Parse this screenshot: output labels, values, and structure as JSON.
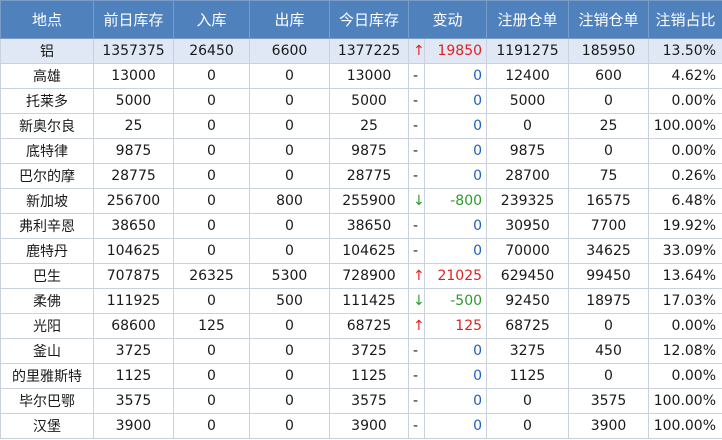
{
  "headers": [
    "地点",
    "前日库存",
    "入库",
    "出库",
    "今日库存",
    "变动",
    "注册仓单",
    "注销仓单",
    "注销占比"
  ],
  "rows": [
    {
      "location": "铝",
      "prev": "1357375",
      "in": "26450",
      "out": "6600",
      "today": "1377225",
      "symbol": "↑",
      "change": "19850",
      "dir": "up",
      "registered": "1191275",
      "cancelled": "185950",
      "ratio": "13.50%"
    },
    {
      "location": "高雄",
      "prev": "13000",
      "in": "0",
      "out": "0",
      "today": "13000",
      "symbol": "-",
      "change": "0",
      "dir": "flat",
      "registered": "12400",
      "cancelled": "600",
      "ratio": "4.62%"
    },
    {
      "location": "托莱多",
      "prev": "5000",
      "in": "0",
      "out": "0",
      "today": "5000",
      "symbol": "-",
      "change": "0",
      "dir": "flat",
      "registered": "5000",
      "cancelled": "0",
      "ratio": "0.00%"
    },
    {
      "location": "新奥尔良",
      "prev": "25",
      "in": "0",
      "out": "0",
      "today": "25",
      "symbol": "-",
      "change": "0",
      "dir": "flat",
      "registered": "0",
      "cancelled": "25",
      "ratio": "100.00%"
    },
    {
      "location": "底特律",
      "prev": "9875",
      "in": "0",
      "out": "0",
      "today": "9875",
      "symbol": "-",
      "change": "0",
      "dir": "flat",
      "registered": "9875",
      "cancelled": "0",
      "ratio": "0.00%"
    },
    {
      "location": "巴尔的摩",
      "prev": "28775",
      "in": "0",
      "out": "0",
      "today": "28775",
      "symbol": "-",
      "change": "0",
      "dir": "flat",
      "registered": "28700",
      "cancelled": "75",
      "ratio": "0.26%"
    },
    {
      "location": "新加坡",
      "prev": "256700",
      "in": "0",
      "out": "800",
      "today": "255900",
      "symbol": "↓",
      "change": "-800",
      "dir": "down",
      "registered": "239325",
      "cancelled": "16575",
      "ratio": "6.48%"
    },
    {
      "location": "弗利辛恩",
      "prev": "38650",
      "in": "0",
      "out": "0",
      "today": "38650",
      "symbol": "-",
      "change": "0",
      "dir": "flat",
      "registered": "30950",
      "cancelled": "7700",
      "ratio": "19.92%"
    },
    {
      "location": "鹿特丹",
      "prev": "104625",
      "in": "0",
      "out": "0",
      "today": "104625",
      "symbol": "-",
      "change": "0",
      "dir": "flat",
      "registered": "70000",
      "cancelled": "34625",
      "ratio": "33.09%"
    },
    {
      "location": "巴生",
      "prev": "707875",
      "in": "26325",
      "out": "5300",
      "today": "728900",
      "symbol": "↑",
      "change": "21025",
      "dir": "up",
      "registered": "629450",
      "cancelled": "99450",
      "ratio": "13.64%"
    },
    {
      "location": "柔佛",
      "prev": "111925",
      "in": "0",
      "out": "500",
      "today": "111425",
      "symbol": "↓",
      "change": "-500",
      "dir": "down",
      "registered": "92450",
      "cancelled": "18975",
      "ratio": "17.03%"
    },
    {
      "location": "光阳",
      "prev": "68600",
      "in": "125",
      "out": "0",
      "today": "68725",
      "symbol": "↑",
      "change": "125",
      "dir": "up",
      "registered": "68725",
      "cancelled": "0",
      "ratio": "0.00%"
    },
    {
      "location": "釜山",
      "prev": "3725",
      "in": "0",
      "out": "0",
      "today": "3725",
      "symbol": "-",
      "change": "0",
      "dir": "flat",
      "registered": "3275",
      "cancelled": "450",
      "ratio": "12.08%"
    },
    {
      "location": "的里雅斯特",
      "prev": "1125",
      "in": "0",
      "out": "0",
      "today": "1125",
      "symbol": "-",
      "change": "0",
      "dir": "flat",
      "registered": "1125",
      "cancelled": "0",
      "ratio": "0.00%"
    },
    {
      "location": "毕尔巴鄂",
      "prev": "3575",
      "in": "0",
      "out": "0",
      "today": "3575",
      "symbol": "-",
      "change": "0",
      "dir": "flat",
      "registered": "0",
      "cancelled": "3575",
      "ratio": "100.00%"
    },
    {
      "location": "汉堡",
      "prev": "3900",
      "in": "0",
      "out": "0",
      "today": "3900",
      "symbol": "-",
      "change": "0",
      "dir": "flat",
      "registered": "0",
      "cancelled": "3900",
      "ratio": "100.00%"
    }
  ],
  "colors": {
    "header_bg": "#4f81bd",
    "highlight_row": "#dfe8f4",
    "up": "#e02020",
    "down": "#2e9a2e",
    "flat": "#1f5fbf"
  }
}
